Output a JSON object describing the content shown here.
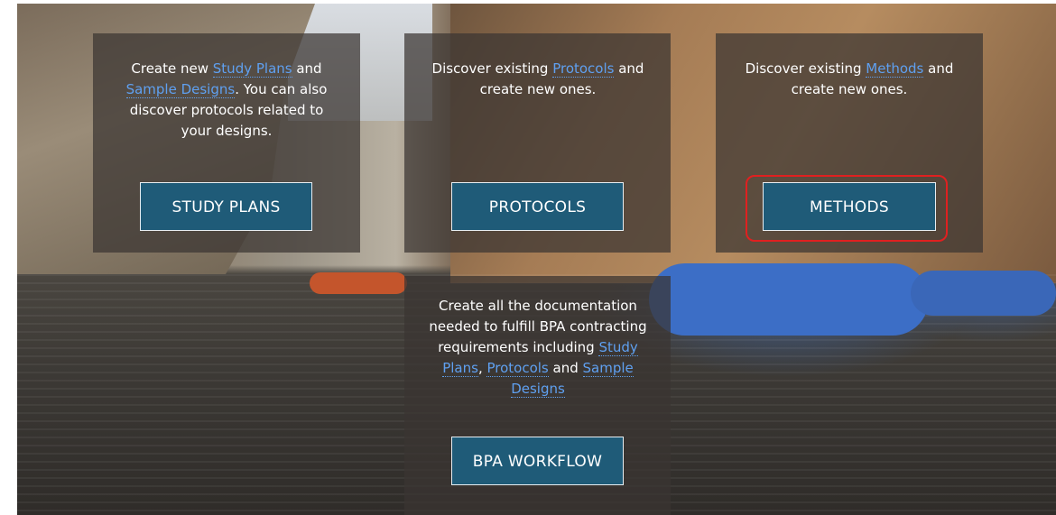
{
  "cards": {
    "study_plans": {
      "t1": "Create new ",
      "l1": "Study Plans",
      "t2": " and",
      "l2": "Sample Designs",
      "t3": ". You can also discover protocols related to your designs.",
      "button": "STUDY PLANS"
    },
    "protocols": {
      "t1": "Discover existing ",
      "l1": "Protocols",
      "t2": " and create new ones.",
      "button": "PROTOCOLS"
    },
    "methods": {
      "t1": "Discover existing ",
      "l1": "Methods",
      "t2": " and create new ones.",
      "button": "METHODS"
    },
    "bpa": {
      "t1": "Create all the documentation needed to fulfill BPA contracting requirements including ",
      "l1": "Study Plans",
      "t2": ", ",
      "l2": "Protocols",
      "t3": " and ",
      "l3": "Sample Designs",
      "button": "BPA WORKFLOW"
    }
  },
  "colors": {
    "button_bg": "#1f5b78",
    "link": "#5fa0f0",
    "highlight": "#e02020"
  }
}
